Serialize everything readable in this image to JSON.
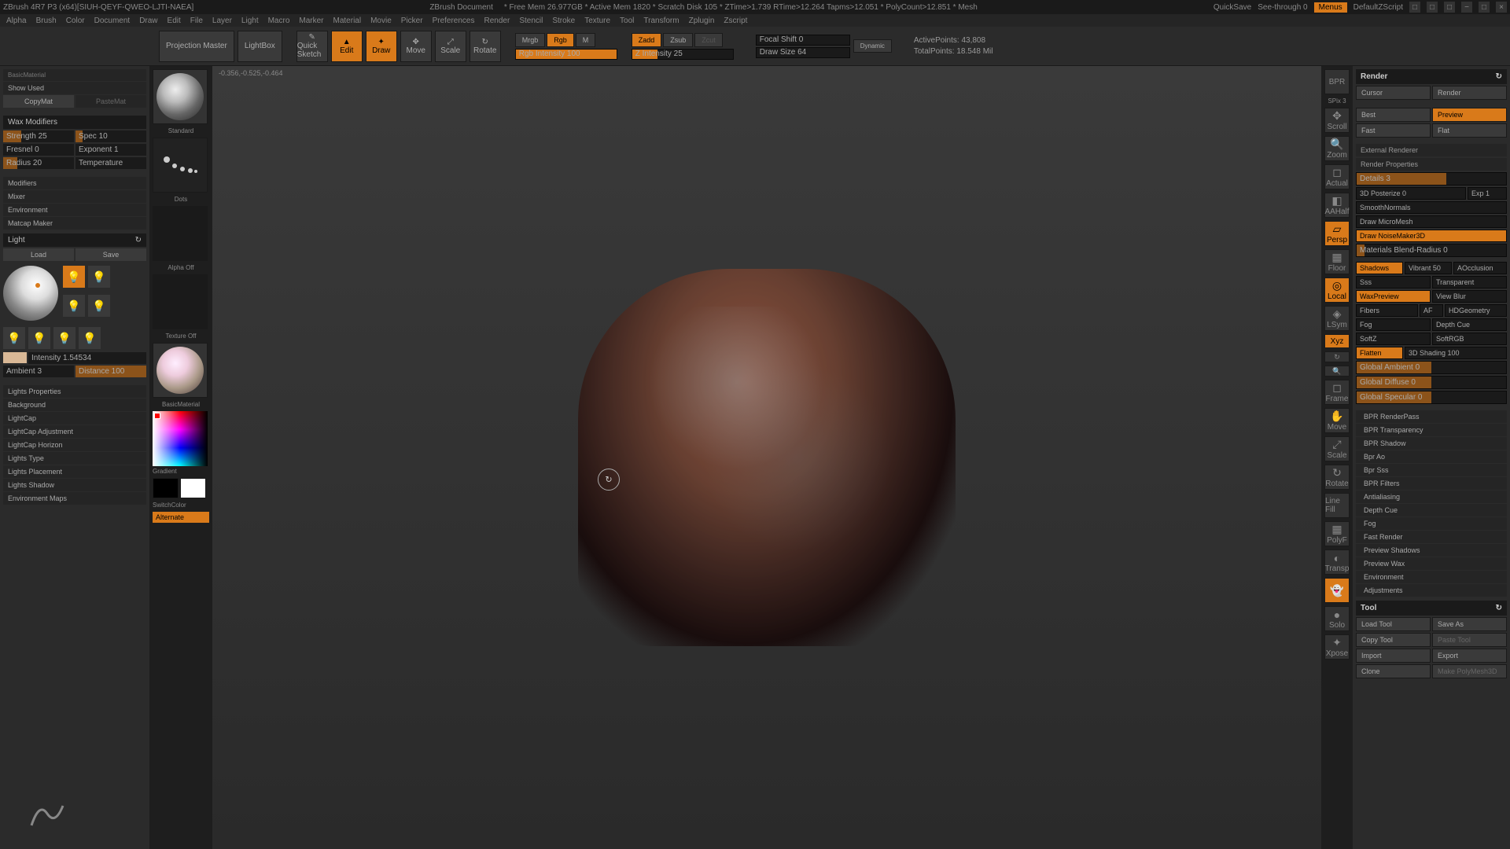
{
  "title": "ZBrush 4R7 P3 (x64)[SIUH-QEYF-QWEO-LJTI-NAEA]",
  "doc_title": "ZBrush Document",
  "stats": "* Free Mem 26.977GB * Active Mem 1820 * Scratch Disk 105 * ZTime>1.739 RTime>12.264 Tapms>12.051 * PolyCount>12.851 * Mesh",
  "titlebar_right": {
    "quicksave": "QuickSave",
    "seethrough": "See-through 0",
    "menus": "Menus",
    "script": "DefaultZScript"
  },
  "menus": [
    "Alpha",
    "Brush",
    "Color",
    "Document",
    "Draw",
    "Edit",
    "File",
    "Layer",
    "Light",
    "Macro",
    "Marker",
    "Material",
    "Movie",
    "Picker",
    "Preferences",
    "Render",
    "Stencil",
    "Stroke",
    "Texture",
    "Tool",
    "Transform",
    "Zplugin",
    "Zscript"
  ],
  "coords": "-0.356,-0.525,-0.464",
  "toolbar": {
    "projection": "Projection Master",
    "lightbox": "LightBox",
    "quicksketch": "Quick Sketch",
    "edit": "Edit",
    "draw": "Draw",
    "move": "Move",
    "scale": "Scale",
    "rotate": "Rotate",
    "mrgb": "Mrgb",
    "rgb": "Rgb",
    "m": "M",
    "rgb_intensity": "Rgb Intensity 100",
    "zadd": "Zadd",
    "zsub": "Zsub",
    "zcut": "Zcut",
    "z_intensity": "Z Intensity 25",
    "focal": "Focal Shift 0",
    "drawsize": "Draw Size 64",
    "dynamic": "Dynamic",
    "activepoints": "ActivePoints: 43,808",
    "totalpoints": "TotalPoints: 18.548 Mil"
  },
  "left": {
    "basic_material": "BasicMaterial",
    "show_used": "Show Used",
    "copymat": "CopyMat",
    "pastemat": "PasteMat",
    "wax_modifiers": "Wax Modifiers",
    "strength": "Strength 25",
    "spec": "Spec 10",
    "fresnel": "Fresnel 0",
    "exponent": "Exponent 1",
    "radius": "Radius 20",
    "temperature": "Temperature",
    "modifiers": "Modifiers",
    "mixer": "Mixer",
    "environment": "Environment",
    "matcap": "Matcap Maker",
    "light_title": "Light",
    "load": "Load",
    "save": "Save",
    "intensity": "Intensity 1.54534",
    "ambient": "Ambient 3",
    "distance": "Distance 100",
    "lights_props": "Lights Properties",
    "background": "Background",
    "lightcap": "LightCap",
    "lightcap_adj": "LightCap Adjustment",
    "lightcap_hor": "LightCap Horizon",
    "lights_type": "Lights Type",
    "lights_place": "Lights Placement",
    "lights_shadow": "Lights Shadow",
    "env_maps": "Environment Maps"
  },
  "tray": {
    "standard": "Standard",
    "dots": "Dots",
    "alpha_off": "Alpha Off",
    "texture_off": "Texture Off",
    "basic_material": "BasicMaterial",
    "gradient": "Gradient",
    "switchcolor": "SwitchColor",
    "alternate": "Alternate"
  },
  "right_icons": {
    "bpr": "BPR",
    "spix": "SPix 3",
    "scroll": "Scroll",
    "zoom": "Zoom",
    "actual": "Actual",
    "aahalf": "AAHalf",
    "persp": "Persp",
    "floor": "Floor",
    "local": "Local",
    "lsym": "LSym",
    "xyz": "Xyz",
    "frame": "Frame",
    "move": "Move",
    "scale": "Scale",
    "rotate": "Rotate",
    "linefill": "Line Fill",
    "polyf": "PolyF",
    "transp": "Transp",
    "ghost": "Ghost",
    "solo": "Solo",
    "xpose": "Xpose"
  },
  "render": {
    "title": "Render",
    "cursor": "Cursor",
    "render_btn": "Render",
    "best": "Best",
    "preview": "Preview",
    "fast": "Fast",
    "flat": "Flat",
    "ext_renderer": "External Renderer",
    "render_props": "Render Properties",
    "details": "Details 3",
    "posterize": "3D Posterize 0",
    "exp": "Exp 1",
    "smoothnormals": "SmoothNormals",
    "micromesh": "Draw MicroMesh",
    "noisemaker": "Draw NoiseMaker3D",
    "blendradius": "Materials Blend-Radius 0",
    "shadows": "Shadows",
    "vibrant": "Vibrant 50",
    "aocclusion": "AOcclusion",
    "sss": "Sss",
    "transparent": "Transparent",
    "waxpreview": "WaxPreview",
    "viewblur": "View Blur",
    "fibers": "Fibers",
    "af": "AF",
    "hdgeometry": "HDGeometry",
    "fog": "Fog",
    "depthcue": "Depth Cue",
    "softz": "SoftZ",
    "softrgb": "SoftRGB",
    "flatten": "Flatten",
    "shading3d": "3D Shading 100",
    "global_ambient": "Global Ambient 0",
    "global_diffuse": "Global Diffuse 0",
    "global_specular": "Global Specular 0",
    "bpr_renderpass": "BPR RenderPass",
    "bpr_transparency": "BPR Transparency",
    "bpr_shadow": "BPR Shadow",
    "bpr_ao": "Bpr Ao",
    "bpr_sss": "Bpr Sss",
    "bpr_filters": "BPR Filters",
    "antialiasing": "Antialiasing",
    "depth_cue2": "Depth Cue",
    "fog2": "Fog",
    "fast_render": "Fast Render",
    "preview_shadows": "Preview Shadows",
    "preview_wax": "Preview Wax",
    "environment2": "Environment",
    "adjustments": "Adjustments"
  },
  "tool": {
    "title": "Tool",
    "load": "Load Tool",
    "saveas": "Save As",
    "copy": "Copy Tool",
    "paste": "Paste Tool",
    "import": "Import",
    "export": "Export",
    "clone": "Clone",
    "polymesh": "Make PolyMesh3D"
  }
}
